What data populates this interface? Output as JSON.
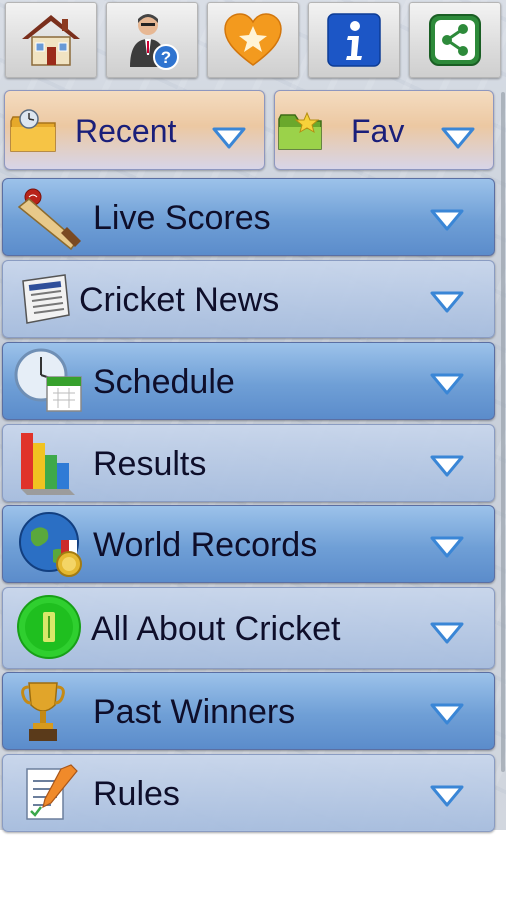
{
  "toolbar": {
    "items": [
      {
        "icon": "home-icon"
      },
      {
        "icon": "help-person-icon"
      },
      {
        "icon": "favorite-heart-icon"
      },
      {
        "icon": "info-icon"
      },
      {
        "icon": "share-icon"
      }
    ]
  },
  "quick": {
    "recent_label": "Recent",
    "fav_label": "Fav"
  },
  "menu": {
    "items": [
      {
        "label": "Live Scores",
        "icon": "cricket-bat-icon",
        "style": "blue"
      },
      {
        "label": "Cricket News",
        "icon": "newspaper-icon",
        "style": "light"
      },
      {
        "label": "Schedule",
        "icon": "clock-calendar-icon",
        "style": "blue"
      },
      {
        "label": "Results",
        "icon": "bar-chart-icon",
        "style": "light"
      },
      {
        "label": "World Records",
        "icon": "globe-medal-icon",
        "style": "blue"
      },
      {
        "label": "All About Cricket",
        "icon": "cricket-pitch-icon",
        "style": "light"
      },
      {
        "label": "Past Winners",
        "icon": "trophy-icon",
        "style": "blue"
      },
      {
        "label": "Rules",
        "icon": "rules-clipboard-icon",
        "style": "light"
      }
    ]
  },
  "colors": {
    "accent_blue": "#6f9fd6",
    "label_navy": "#1a1f7a",
    "chevron": "#3a86d6"
  }
}
